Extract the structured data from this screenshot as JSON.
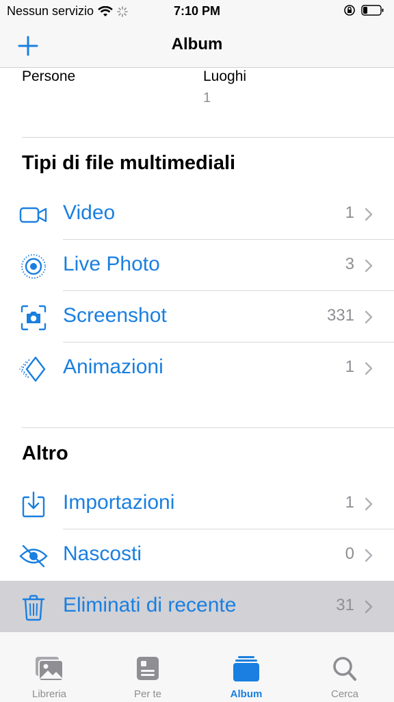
{
  "status_bar": {
    "carrier": "Nessun servizio",
    "time": "7:10 PM"
  },
  "nav": {
    "title": "Album",
    "add_icon": "plus-icon"
  },
  "people_places": {
    "people_label": "Persone",
    "places_label": "Luoghi",
    "places_count": "1"
  },
  "media_types": {
    "title": "Tipi di file multimediali",
    "items": [
      {
        "label": "Video",
        "count": "1",
        "icon": "video-camera-icon"
      },
      {
        "label": "Live Photo",
        "count": "3",
        "icon": "live-photo-icon"
      },
      {
        "label": "Screenshot",
        "count": "331",
        "icon": "screenshot-icon"
      },
      {
        "label": "Animazioni",
        "count": "1",
        "icon": "animated-icon"
      }
    ]
  },
  "other": {
    "title": "Altro",
    "items": [
      {
        "label": "Importazioni",
        "count": "1",
        "icon": "import-icon"
      },
      {
        "label": "Nascosti",
        "count": "0",
        "icon": "eye-slash-icon"
      },
      {
        "label": "Eliminati di recente",
        "count": "31",
        "icon": "trash-icon",
        "selected": true
      }
    ]
  },
  "tabs": [
    {
      "label": "Libreria",
      "icon": "photos-library-icon",
      "active": false
    },
    {
      "label": "Per te",
      "icon": "for-you-icon",
      "active": false
    },
    {
      "label": "Album",
      "icon": "album-stack-icon",
      "active": true
    },
    {
      "label": "Cerca",
      "icon": "search-icon",
      "active": false
    }
  ],
  "colors": {
    "accent": "#1a7fe0",
    "secondary_text": "#8e8e93",
    "bar_background": "#f7f7f7",
    "selected_row": "#d1d1d6"
  }
}
